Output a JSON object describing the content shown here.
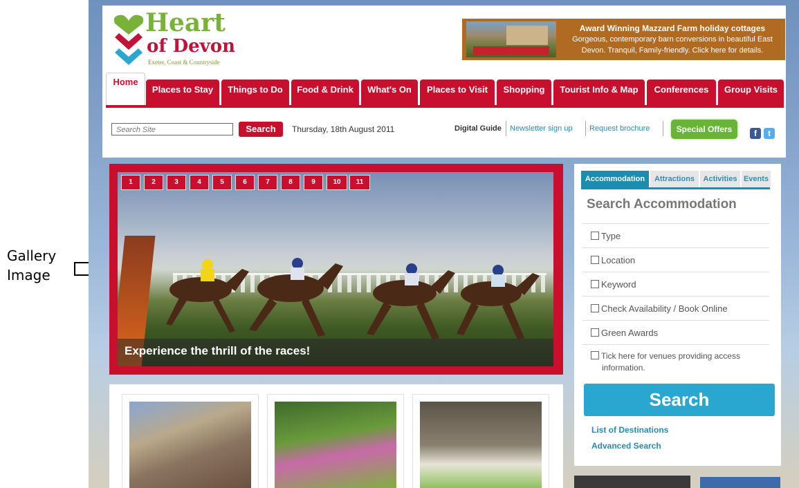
{
  "annotation": {
    "label_line1": "Gallery",
    "label_line2": "Image"
  },
  "logo": {
    "title": "Heart",
    "subtitle": "of Devon",
    "tagline": "Exeter, Coast & Countryside"
  },
  "banner": {
    "line1": "Award Winning Mazzard Farm holiday cottages",
    "line2": "Gorgeous, contemporary barn conversions in beautiful East",
    "line3": "Devon. Tranquil, Family-friendly. Click here for details."
  },
  "nav": {
    "tabs": [
      "Home",
      "Places to Stay",
      "Things to Do",
      "Food & Drink",
      "What's On",
      "Places to Visit",
      "Shopping",
      "Tourist Info & Map",
      "Conferences",
      "Group Visits"
    ]
  },
  "search": {
    "placeholder": "Search Site",
    "button": "Search"
  },
  "date": "Thursday, 18th August 2011",
  "utility": {
    "digital_guide": "Digital Guide",
    "newsletter": "Newsletter sign up",
    "brochure": "Request brochure",
    "offers": "Special Offers"
  },
  "social": {
    "facebook": "f",
    "twitter": "t"
  },
  "gallery": {
    "numbers": [
      "1",
      "2",
      "3",
      "4",
      "5",
      "6",
      "7",
      "8",
      "9",
      "10",
      "11"
    ],
    "caption": "Experience the thrill of the races!"
  },
  "panel": {
    "tabs": [
      "Accommodation",
      "Attractions",
      "Activities",
      "Events"
    ],
    "title": "Search Accommodation",
    "options": [
      "Type",
      "Location",
      "Keyword",
      "Check Availability / Book Online",
      "Green Awards"
    ],
    "access_line1": "Tick here for venues providing access",
    "access_line2": "information.",
    "search_button": "Search",
    "links": [
      "List of Destinations",
      "Advanced Search"
    ]
  },
  "colors": {
    "brand_red": "#c8102e",
    "accent_blue": "#1c8db0",
    "green": "#68b436"
  }
}
